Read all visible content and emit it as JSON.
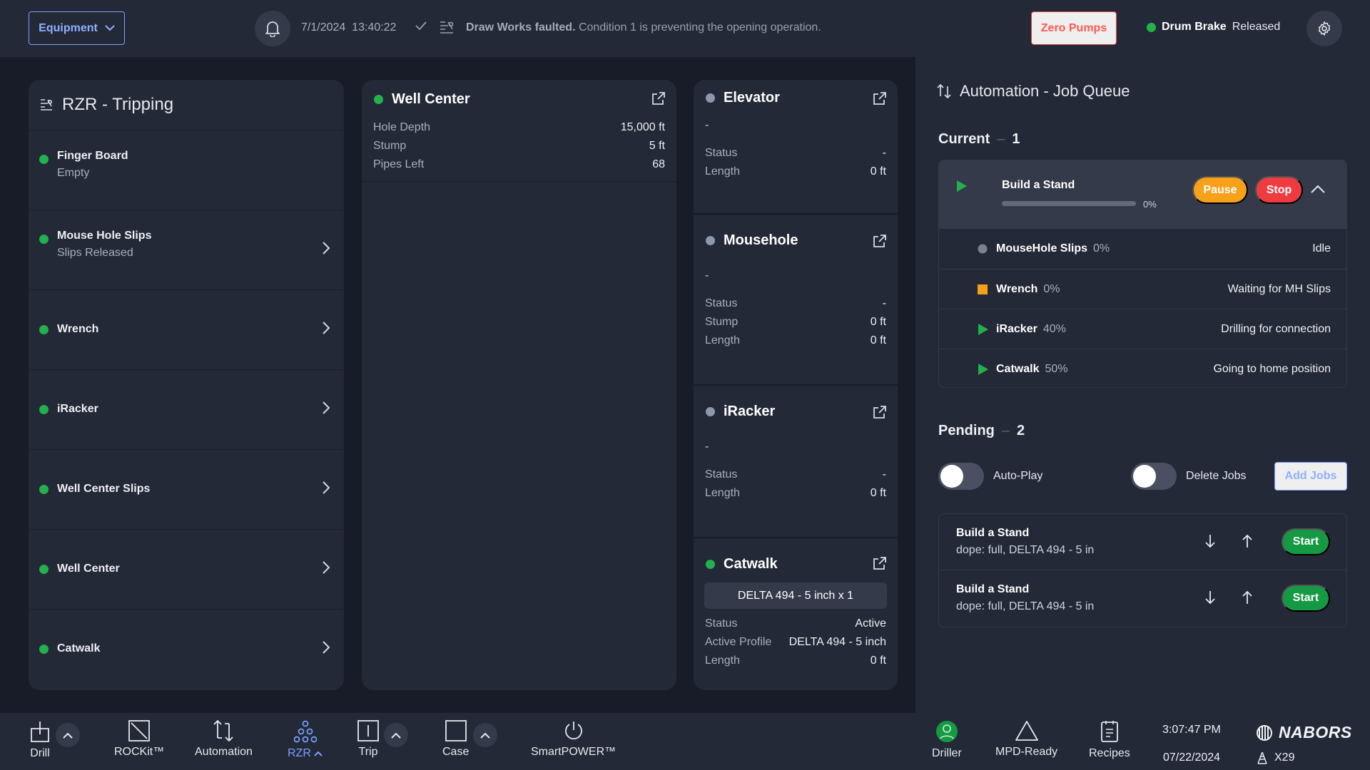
{
  "topbar": {
    "equipment_label": "Equipment",
    "date": "7/1/2024",
    "time": "13:40:22",
    "alert_bold": "Draw Works faulted.",
    "alert_text": "Condition 1 is preventing the opening operation.",
    "zero_pumps_label": "Zero Pumps",
    "drum_brake_label": "Drum Brake",
    "drum_brake_status": "Released"
  },
  "rzr": {
    "title": "RZR - Tripping",
    "items": [
      {
        "name": "Finger Board",
        "sub": "Empty"
      },
      {
        "name": "Mouse Hole Slips",
        "sub": "Slips Released"
      },
      {
        "name": "Wrench",
        "sub": ""
      },
      {
        "name": "iRacker",
        "sub": ""
      },
      {
        "name": "Well Center Slips",
        "sub": ""
      },
      {
        "name": "Well Center",
        "sub": ""
      },
      {
        "name": "Catwalk",
        "sub": ""
      }
    ]
  },
  "well_center": {
    "title": "Well Center",
    "rows": [
      {
        "k": "Hole Depth",
        "v": "15,000 ft"
      },
      {
        "k": "Stump",
        "v": "5 ft"
      },
      {
        "k": "Pipes Left",
        "v": "68"
      }
    ]
  },
  "elevator": {
    "title": "Elevator",
    "dash": "-",
    "rows": [
      {
        "k": "Status",
        "v": "-"
      },
      {
        "k": "Length",
        "v": "0 ft"
      }
    ]
  },
  "mousehole": {
    "title": "Mousehole",
    "dash": "-",
    "rows": [
      {
        "k": "Status",
        "v": "-"
      },
      {
        "k": "Stump",
        "v": "0 ft"
      },
      {
        "k": "Length",
        "v": "0 ft"
      }
    ]
  },
  "iracker": {
    "title": "iRacker",
    "dash": "-",
    "rows": [
      {
        "k": "Status",
        "v": "-"
      },
      {
        "k": "Length",
        "v": "0 ft"
      }
    ]
  },
  "catwalk": {
    "title": "Catwalk",
    "pipe": "DELTA 494 - 5 inch x 1",
    "rows": [
      {
        "k": "Status",
        "v": "Active"
      },
      {
        "k": "Active Profile",
        "v": "DELTA 494 - 5 inch"
      },
      {
        "k": "Length",
        "v": "0 ft"
      }
    ]
  },
  "automation": {
    "title": "Automation - Job Queue",
    "current_label": "Current",
    "current_count": "1",
    "current_job": {
      "name": "Build a Stand",
      "progress": 0,
      "progress_text": "0%",
      "pause_label": "Pause",
      "stop_label": "Stop"
    },
    "tasks": [
      {
        "name": "MouseHole Slips",
        "pct": "0%",
        "status": "Idle",
        "state": "idle"
      },
      {
        "name": "Wrench",
        "pct": "0%",
        "status": "Waiting for MH Slips",
        "state": "waiting"
      },
      {
        "name": "iRacker",
        "pct": "40%",
        "status": "Drilling for connection",
        "state": "running"
      },
      {
        "name": "Catwalk",
        "pct": "50%",
        "status": "Going to home position",
        "state": "running"
      }
    ],
    "pending_label": "Pending",
    "pending_count": "2",
    "autoplay_label": "Auto-Play",
    "delete_jobs_label": "Delete Jobs",
    "add_jobs_label": "Add Jobs",
    "pending_jobs": [
      {
        "name": "Build a Stand",
        "detail": "dope: full, DELTA 494 - 5 in",
        "start_label": "Start"
      },
      {
        "name": "Build a Stand",
        "detail": "dope: full, DELTA 494 - 5 in",
        "start_label": "Start"
      }
    ]
  },
  "bottombar": {
    "drill": "Drill",
    "rockit": "ROCKit™",
    "automation": "Automation",
    "rzr": "RZR",
    "trip": "Trip",
    "case": "Case",
    "smartpower": "SmartPOWER™",
    "driller": "Driller",
    "mpd": "MPD-Ready",
    "recipes": "Recipes",
    "time": "3:07:47 PM",
    "date": "07/22/2024",
    "brand": "NABORS",
    "rig": "X29"
  },
  "colors": {
    "background": "#171c28",
    "panel": "#232937",
    "accent": "#7aa2ff",
    "ok": "#22b14c",
    "warning": "#f7a11a",
    "danger": "#ef3b3f"
  }
}
